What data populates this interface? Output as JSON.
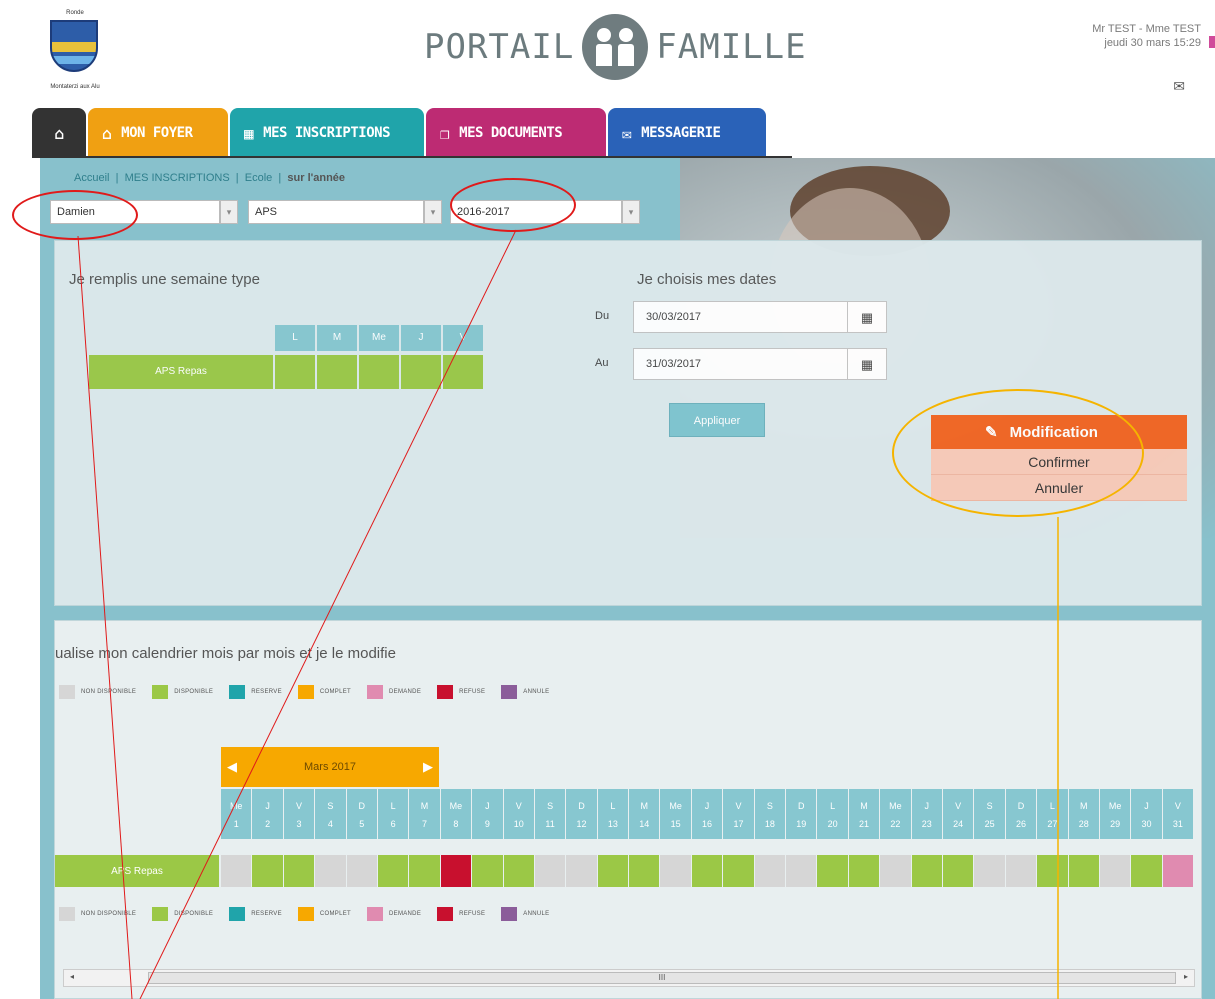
{
  "header": {
    "logo_top": "Ronde",
    "logo_bottom": "Montaterzi aux Alu",
    "brand_left": "PORTAIL",
    "brand_right": "FAMILLE",
    "user": "Mr TEST - Mme TEST",
    "datetime": "jeudi 30 mars 15:29",
    "mail_icon": "envelope-icon"
  },
  "tabs": [
    {
      "label": "",
      "icon": "home-icon",
      "color": "#333333"
    },
    {
      "label": "MON FOYER",
      "icon": "house-icon",
      "color": "#f0a012"
    },
    {
      "label": "MES INSCRIPTIONS",
      "icon": "calendar-icon",
      "color": "#20a4aa"
    },
    {
      "label": "MES DOCUMENTS",
      "icon": "documents-icon",
      "color": "#bd2b73"
    },
    {
      "label": "MESSAGERIE",
      "icon": "envelope-icon",
      "color": "#2a62b8"
    }
  ],
  "breadcrumb": {
    "a": "Accueil",
    "b": "MES INSCRIPTIONS",
    "c": "Ecole",
    "d": "sur l'année"
  },
  "filters": {
    "child": "Damien",
    "activity": "APS",
    "year": "2016-2017"
  },
  "week_section": {
    "title": "Je remplis une semaine type",
    "days": [
      "L",
      "M",
      "Me",
      "J",
      "V"
    ],
    "row_label": "APS Repas"
  },
  "dates_section": {
    "title": "Je choisis mes dates",
    "from_label": "Du",
    "from_value": "30/03/2017",
    "to_label": "Au",
    "to_value": "31/03/2017",
    "apply_label": "Appliquer",
    "calendar_icon": "calendar-icon"
  },
  "modification": {
    "title": "Modification",
    "icon": "pencil-icon",
    "confirm": "Confirmer",
    "cancel": "Annuler"
  },
  "calendar_section": {
    "title": "ualise mon calendrier mois par mois et je le modifie",
    "legend": [
      {
        "label": "NON DISPONIBLE",
        "color": "#d6d6d6"
      },
      {
        "label": "DISPONIBLE",
        "color": "#9bc846"
      },
      {
        "label": "RESERVE",
        "color": "#20a4aa"
      },
      {
        "label": "COMPLET",
        "color": "#f7a800"
      },
      {
        "label": "DEMANDE",
        "color": "#e08bb0"
      },
      {
        "label": "REFUSE",
        "color": "#c8102e"
      },
      {
        "label": "ANNULE",
        "color": "#8b5d9a"
      }
    ],
    "month": "Mars 2017",
    "row_label": "APS Repas",
    "day_names": [
      "Me",
      "J",
      "V",
      "S",
      "D",
      "L",
      "M",
      "Me",
      "J",
      "V",
      "S",
      "D",
      "L",
      "M",
      "Me",
      "J",
      "V",
      "S",
      "D",
      "L",
      "M",
      "Me",
      "J",
      "V",
      "S",
      "D",
      "L",
      "M",
      "Me",
      "J",
      "V"
    ],
    "day_numbers": [
      "1",
      "2",
      "3",
      "4",
      "5",
      "6",
      "7",
      "8",
      "9",
      "10",
      "11",
      "12",
      "13",
      "14",
      "15",
      "16",
      "17",
      "18",
      "19",
      "20",
      "21",
      "22",
      "23",
      "24",
      "25",
      "26",
      "27",
      "28",
      "29",
      "30",
      "31"
    ],
    "cell_status": [
      "N",
      "D",
      "D",
      "N",
      "N",
      "D",
      "D",
      "R",
      "D",
      "D",
      "N",
      "N",
      "D",
      "D",
      "N",
      "D",
      "D",
      "N",
      "N",
      "D",
      "D",
      "N",
      "D",
      "D",
      "N",
      "N",
      "D",
      "D",
      "N",
      "D",
      "M"
    ],
    "scroll_thumb": "III"
  },
  "status_colors": {
    "N": "#d6d6d6",
    "D": "#9bc846",
    "R": "#c8102e",
    "M": "#e08bb0"
  }
}
